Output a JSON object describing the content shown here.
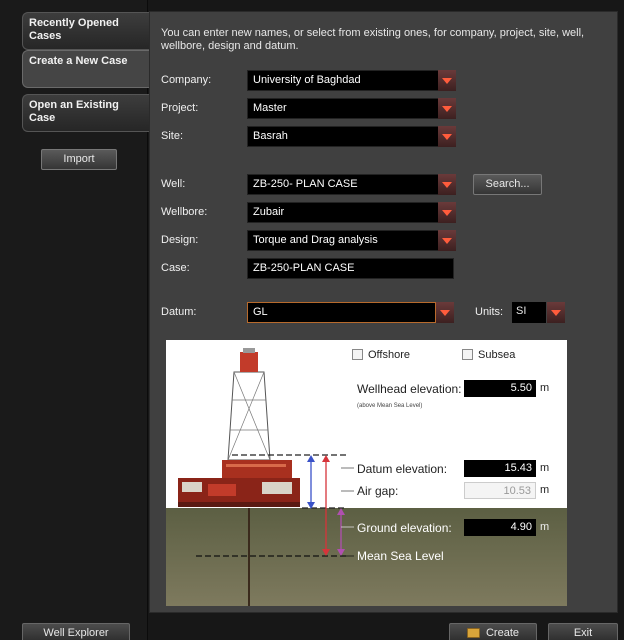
{
  "sidebar": {
    "tabs": [
      {
        "label": "Recently Opened Cases"
      },
      {
        "label": "Create a New Case"
      },
      {
        "label": "Open an Existing Case"
      }
    ],
    "import_label": "Import"
  },
  "intro_text": "You can enter new names, or select from existing ones, for company, project, site, well, wellbore, design and datum.",
  "form": {
    "company": {
      "label": "Company:",
      "value": "University of Baghdad"
    },
    "project": {
      "label": "Project:",
      "value": "Master"
    },
    "site": {
      "label": "Site:",
      "value": "Basrah"
    },
    "well": {
      "label": "Well:",
      "value": "ZB-250- PLAN CASE"
    },
    "search_label": "Search...",
    "wellbore": {
      "label": "Wellbore:",
      "value": "Zubair"
    },
    "design": {
      "label": "Design:",
      "value": "Torque and Drag analysis"
    },
    "case": {
      "label": "Case:",
      "value": "ZB-250-PLAN CASE"
    },
    "datum": {
      "label": "Datum:",
      "value": "GL"
    },
    "units": {
      "label": "Units:",
      "value": "SI"
    }
  },
  "diagram": {
    "offshore_label": "Offshore",
    "offshore_checked": false,
    "subsea_label": "Subsea",
    "subsea_checked": false,
    "wellhead_elevation": {
      "label": "Wellhead elevation:",
      "value": "5.50",
      "unit": "m"
    },
    "wellhead_note": "(above Mean Sea Level)",
    "datum_elevation": {
      "label": "Datum elevation:",
      "value": "15.43",
      "unit": "m"
    },
    "air_gap": {
      "label": "Air gap:",
      "value": "10.53",
      "unit": "m"
    },
    "ground_elevation": {
      "label": "Ground elevation:",
      "value": "4.90",
      "unit": "m"
    },
    "mean_sea_level": "Mean Sea Level"
  },
  "footer": {
    "well_explorer_label": "Well Explorer",
    "create_label": "Create",
    "exit_label": "Exit"
  },
  "colors": {
    "background": "#171717",
    "panel": "#404040",
    "dropdown_arrow": "#ff5c3c",
    "datum_arrow": "#d6343a",
    "ground_arrow": "#b04fb0",
    "air_gap_arrow": "#3a52c8"
  }
}
